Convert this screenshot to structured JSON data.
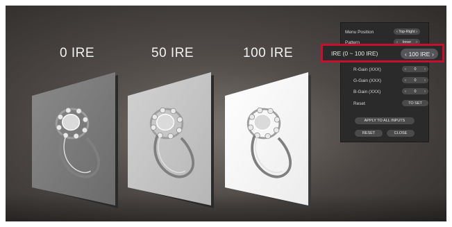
{
  "scene": {
    "labels": [
      "0 IRE",
      "50 IRE",
      "100 IRE"
    ]
  },
  "menu": {
    "menu_position": {
      "label": "Menu Position",
      "value": "Top-Right"
    },
    "pattern": {
      "label": "Pattern",
      "value": "Inner"
    },
    "ire": {
      "label": "IRE (0 ~ 100 IRE)",
      "value": "100 IRE"
    },
    "r_gain": {
      "label": "R-Gain (XXX)",
      "value": "0"
    },
    "g_gain": {
      "label": "G-Gain (XXX)",
      "value": "0"
    },
    "b_gain": {
      "label": "B-Gain (XXX)",
      "value": "0"
    },
    "reset": {
      "label": "Reset",
      "button": "TO SET"
    },
    "apply_all": "APPLY TO ALL INPUTS",
    "reset_button": "RESET",
    "close_button": "CLOSE"
  },
  "icons": {
    "left": "chevron-left-icon",
    "right": "chevron-right-icon"
  },
  "colors": {
    "highlight_border": "#c8102e"
  }
}
